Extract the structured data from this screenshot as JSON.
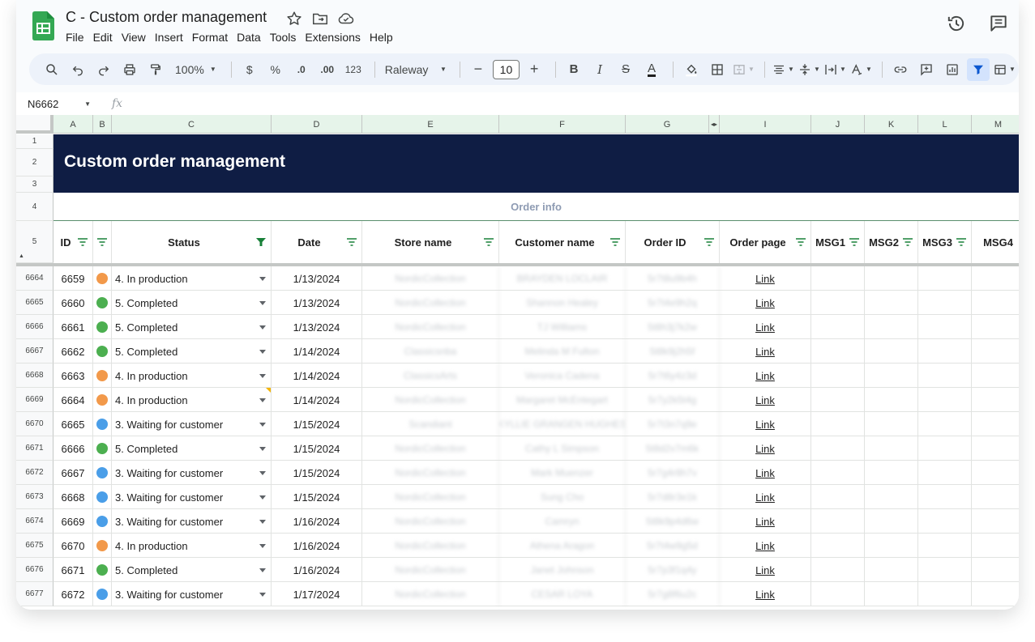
{
  "doc": {
    "title": "C - Custom order management"
  },
  "menu": [
    "File",
    "Edit",
    "View",
    "Insert",
    "Format",
    "Data",
    "Tools",
    "Extensions",
    "Help"
  ],
  "toolbar": {
    "zoom": "100%",
    "currency": "$",
    "percent": "%",
    "dec_decrease": ".0",
    "dec_increase": ".00",
    "number_format": "123",
    "font": "Raleway",
    "font_size": "10"
  },
  "formula_bar": {
    "name_box": "N6662",
    "fx": "fx"
  },
  "columns": [
    "A",
    "B",
    "C",
    "D",
    "E",
    "F",
    "G",
    "I",
    "J",
    "K",
    "L",
    "M"
  ],
  "row_numbers_top": [
    "1",
    "2",
    "3",
    "4",
    "5"
  ],
  "sheet": {
    "banner_title": "Custom order management",
    "section_label": "Order info",
    "headers": [
      "ID",
      "Status",
      "Date",
      "Store name",
      "Customer name",
      "Order ID",
      "Order page",
      "MSG1",
      "MSG2",
      "MSG3",
      "MSG4"
    ]
  },
  "colors": {
    "banner": "#0f1d44",
    "column_header_bg": "#e6f4ea",
    "status_in_production": "#f2994a",
    "status_completed": "#4caf50",
    "status_waiting": "#4a9ee8",
    "active_filter": "#188038"
  },
  "rows": [
    {
      "rownum": "6664",
      "id": "6659",
      "status": "4. In production",
      "dot": "#f2994a",
      "date": "1/13/2024",
      "store": "NordicCollection",
      "customer": "BRAYDEN LOCLAIR",
      "order_id": "5r7t8u9b4h",
      "page": "Link"
    },
    {
      "rownum": "6665",
      "id": "6660",
      "status": "5. Completed",
      "dot": "#4caf50",
      "date": "1/13/2024",
      "store": "NordicCollection",
      "customer": "Shannon Healey",
      "order_id": "5r7t4e9h2q",
      "page": "Link"
    },
    {
      "rownum": "6666",
      "id": "6661",
      "status": "5. Completed",
      "dot": "#4caf50",
      "date": "1/13/2024",
      "store": "NordicCollection",
      "customer": "TJ Williams",
      "order_id": "5t8h3j7k2w",
      "page": "Link"
    },
    {
      "rownum": "6667",
      "id": "6662",
      "status": "5. Completed",
      "dot": "#4caf50",
      "date": "1/14/2024",
      "store": "Classicsnba",
      "customer": "Melinda M Fulton",
      "order_id": "5t8k9j2h5f",
      "page": "Link"
    },
    {
      "rownum": "6668",
      "id": "6663",
      "status": "4. In production",
      "dot": "#f2994a",
      "date": "1/14/2024",
      "store": "ClassicsArts",
      "customer": "Veronica Cadena",
      "order_id": "5r7t6y4z3d",
      "page": "Link"
    },
    {
      "rownum": "6669",
      "id": "6664",
      "status": "4. In production",
      "dot": "#f2994a",
      "date": "1/14/2024",
      "store": "NordicCollection",
      "customer": "Margaret McEntegart",
      "order_id": "5r7y2k5t4g",
      "page": "Link",
      "note": true
    },
    {
      "rownum": "6670",
      "id": "6665",
      "status": "3. Waiting for customer",
      "dot": "#4a9ee8",
      "date": "1/15/2024",
      "store": "Scandiant",
      "customer": "KYLLIE GRANGEN HUGHES",
      "order_id": "5r7t3n7q9e",
      "page": "Link"
    },
    {
      "rownum": "6671",
      "id": "6666",
      "status": "5. Completed",
      "dot": "#4caf50",
      "date": "1/15/2024",
      "store": "NordicCollection",
      "customer": "Cathy L Simpson",
      "order_id": "5t8d2v7m6k",
      "page": "Link"
    },
    {
      "rownum": "6672",
      "id": "6667",
      "status": "3. Waiting for customer",
      "dot": "#4a9ee8",
      "date": "1/15/2024",
      "store": "NordicCollection",
      "customer": "Mark Muenzer",
      "order_id": "5r7g4r8h7v",
      "page": "Link"
    },
    {
      "rownum": "6673",
      "id": "6668",
      "status": "3. Waiting for customer",
      "dot": "#4a9ee8",
      "date": "1/15/2024",
      "store": "NordicCollection",
      "customer": "Sung Cho",
      "order_id": "5r7d8r3e1k",
      "page": "Link"
    },
    {
      "rownum": "6674",
      "id": "6669",
      "status": "3. Waiting for customer",
      "dot": "#4a9ee8",
      "date": "1/16/2024",
      "store": "NordicCollection",
      "customer": "Camryn",
      "order_id": "5t8k9p4d6w",
      "page": "Link"
    },
    {
      "rownum": "6675",
      "id": "6670",
      "status": "4. In production",
      "dot": "#f2994a",
      "date": "1/16/2024",
      "store": "NordicCollection",
      "customer": "Athena Aragon",
      "order_id": "5r7t4w9g5d",
      "page": "Link"
    },
    {
      "rownum": "6676",
      "id": "6671",
      "status": "5. Completed",
      "dot": "#4caf50",
      "date": "1/16/2024",
      "store": "NordicCollection",
      "customer": "Janet Johnson",
      "order_id": "5r7p3f1q4y",
      "page": "Link"
    },
    {
      "rownum": "6677",
      "id": "6672",
      "status": "3. Waiting for customer",
      "dot": "#4a9ee8",
      "date": "1/17/2024",
      "store": "NordicCollection",
      "customer": "CESAR LOYA",
      "order_id": "5r7g8f6u2c",
      "page": "Link"
    }
  ]
}
